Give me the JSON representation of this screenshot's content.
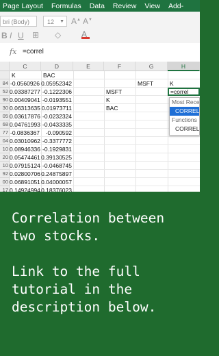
{
  "ribbon": {
    "tabs": [
      "Page Layout",
      "Formulas",
      "Data",
      "Review",
      "View",
      "Add-"
    ],
    "font_name": "bri (Body)",
    "font_size": "12"
  },
  "formula_bar": {
    "fx_label": "fx",
    "value": "=correl"
  },
  "columns": [
    "C",
    "D",
    "E",
    "F",
    "G",
    "H"
  ],
  "header_row": {
    "row": "",
    "c": "K",
    "d": "BAC",
    "e": "",
    "f": "",
    "g": "",
    "h": ""
  },
  "rows": [
    {
      "row": "84",
      "c": "-0.0560926",
      "d": "0.05952342",
      "e": "",
      "f": "",
      "g": "MSFT",
      "h": "K"
    },
    {
      "row": "52",
      "c": "0.03387277",
      "d": "-0.1222306",
      "e": "",
      "f": "MSFT",
      "g": "",
      "h": "=correl"
    },
    {
      "row": "90",
      "c": "0.00409041",
      "d": "-0.0193551",
      "e": "",
      "f": "K",
      "g": "",
      "h": ""
    },
    {
      "row": "30",
      "c": "0.06313635",
      "d": "0.01973711",
      "e": "",
      "f": "BAC",
      "g": "",
      "h": ""
    },
    {
      "row": "05",
      "c": "0.03617876",
      "d": "-0.0232324",
      "e": "",
      "f": "",
      "g": "",
      "h": ""
    },
    {
      "row": "68",
      "c": "0.04761993",
      "d": "-0.0433335",
      "e": "",
      "f": "",
      "g": "",
      "h": ""
    },
    {
      "row": "77",
      "c": "-0.0836367",
      "d": "-0.090592",
      "e": "",
      "f": "",
      "g": "",
      "h": ""
    },
    {
      "row": "04",
      "c": "0.03010962",
      "d": "-0.3377772",
      "e": "",
      "f": "",
      "g": "",
      "h": ""
    },
    {
      "row": "10",
      "c": "0.08946336",
      "d": "-0.1929831",
      "e": "",
      "f": "",
      "g": "",
      "h": ""
    },
    {
      "row": "20",
      "c": "0.05474461",
      "d": "0.39130525",
      "e": "",
      "f": "",
      "g": "",
      "h": ""
    },
    {
      "row": "10",
      "c": "0.07915124",
      "d": "-0.0468745",
      "e": "",
      "f": "",
      "g": "",
      "h": ""
    },
    {
      "row": "92",
      "c": "0.02800706",
      "d": "0.24875897",
      "e": "",
      "f": "",
      "g": "",
      "h": ""
    },
    {
      "row": "00",
      "c": "0.06891051",
      "d": "0.04000057",
      "e": "",
      "f": "",
      "g": "",
      "h": ""
    },
    {
      "row": "17",
      "c": "0.14924994",
      "d": "0.18376023",
      "e": "",
      "f": "",
      "g": "",
      "h": ""
    }
  ],
  "autocomplete": {
    "section_recent": "Most Rece",
    "recent_item": "CORREL",
    "section_functions": "Functions",
    "function_item": "CORREL"
  },
  "caption": {
    "lines": [
      "Correlation between",
      "two stocks.",
      "",
      "Link to the full",
      "tutorial in the",
      "description below."
    ]
  },
  "colors": {
    "excel_green": "#1f7340",
    "background_green": "#1f6b2e",
    "selection_blue": "#1f6fd6"
  }
}
